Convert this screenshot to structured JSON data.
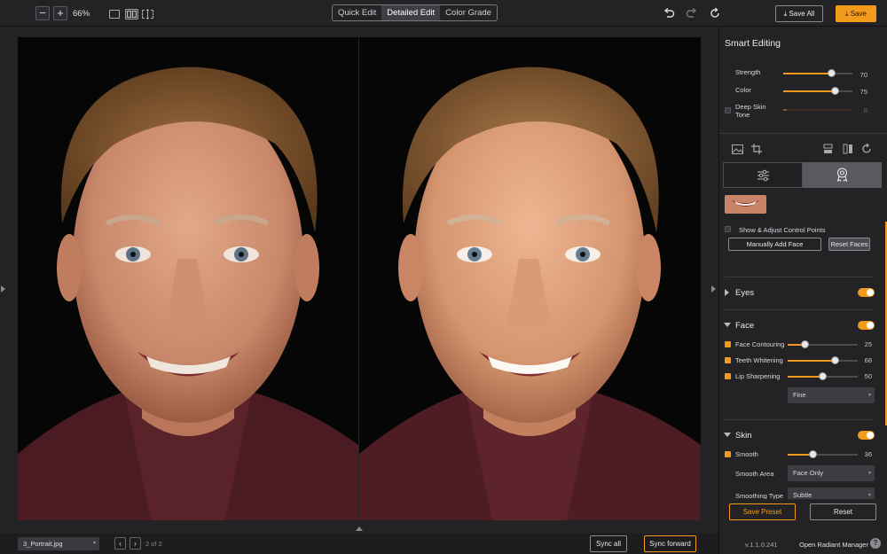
{
  "toolbar": {
    "zoom_out": "−",
    "zoom_in": "+",
    "zoom_level": "66%",
    "modes": [
      "Quick Edit",
      "Detailed Edit",
      "Color Grade"
    ],
    "active_mode": "Detailed Edit",
    "save_all": "Save All",
    "save": "Save"
  },
  "bottombar": {
    "file_name": "3_Portrait.jpg",
    "page_info": "2 of 2",
    "sync_all": "Sync all",
    "sync_forward": "Sync forward"
  },
  "panel": {
    "title": "Smart Editing",
    "strength_label": "Strength",
    "strength_value": "70",
    "strength_level": 0.7,
    "color_label": "Color",
    "color_value": "75",
    "color_level": 0.75,
    "deep_skin_label_1": "Deep Skin",
    "deep_skin_label_2": "Tone",
    "deep_skin_value": "0",
    "show_control_points": "Show & Adjust Control Points",
    "manually_add_face": "Manually Add Face",
    "reset_faces": "Reset Faces",
    "eyes": {
      "title": "Eyes",
      "enabled": true
    },
    "face": {
      "title": "Face",
      "enabled": true,
      "items": [
        {
          "label": "Face Contouring",
          "value": "25",
          "level": 0.25
        },
        {
          "label": "Teeth Whitening",
          "value": "68",
          "level": 0.68
        },
        {
          "label": "Lip Sharpening",
          "value": "50",
          "level": 0.5
        }
      ],
      "lip_mode": "Fine"
    },
    "skin": {
      "title": "Skin",
      "enabled": true,
      "smooth_label": "Smooth",
      "smooth_value": "36",
      "smooth_level": 0.36,
      "smooth_area_label": "Smooth Area",
      "smooth_area_value": "Face Only",
      "smoothing_type_label": "Smoothing Type",
      "smoothing_type_value": "Subtle"
    },
    "save_preset": "Save Preset",
    "reset": "Reset",
    "version": "v.1.1.0.241",
    "open_manager": "Open Radiant Manager",
    "help": "?"
  },
  "colors": {
    "accent": "#f39a1b",
    "panel_bg": "#232326"
  }
}
